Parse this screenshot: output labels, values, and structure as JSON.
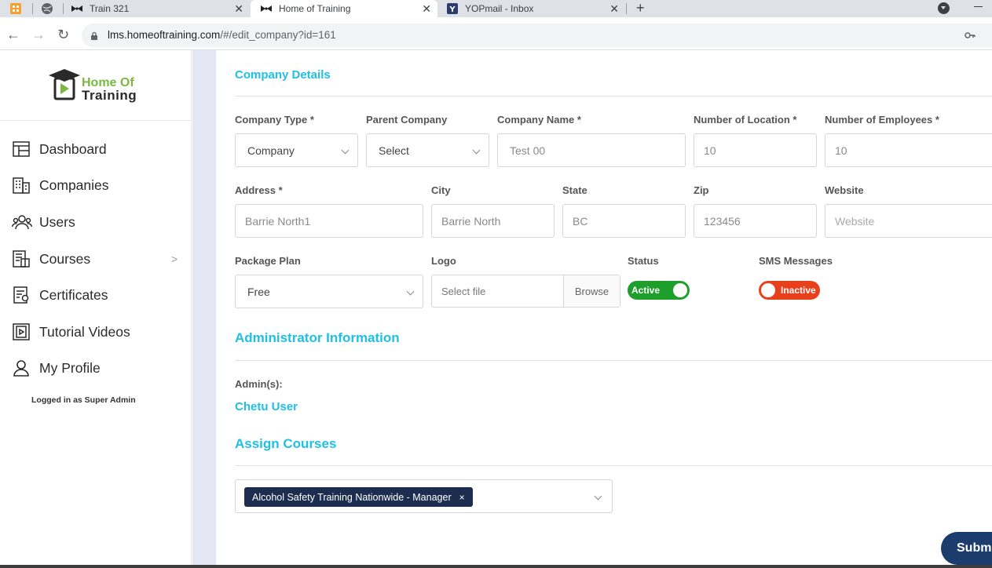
{
  "browser": {
    "tabs": [
      {
        "label": "",
        "icon": "app-icon"
      },
      {
        "label": "",
        "icon": "globe-icon"
      },
      {
        "label": "Train 321",
        "icon": "bowtie-icon"
      },
      {
        "label": "Home of Training",
        "icon": "bowtie-icon",
        "active": true
      },
      {
        "label": "YOPmail - Inbox",
        "icon": "yopmail-icon"
      }
    ],
    "url_domain": "lms.homeoftraining.com",
    "url_path": "/#/edit_company?id=161"
  },
  "sidebar": {
    "logo_line1": "Home Of",
    "logo_line2": "Training",
    "items": [
      {
        "label": "Dashboard",
        "icon": "dashboard-icon"
      },
      {
        "label": "Companies",
        "icon": "building-icon"
      },
      {
        "label": "Users",
        "icon": "users-icon"
      },
      {
        "label": "Courses",
        "icon": "courses-icon"
      },
      {
        "label": "Certificates",
        "icon": "certificate-icon"
      },
      {
        "label": "Tutorial Videos",
        "icon": "video-icon"
      },
      {
        "label": "My Profile",
        "icon": "profile-icon"
      }
    ],
    "logged_in": "Logged in as Super Admin"
  },
  "company": {
    "title": "Company Details",
    "fields": {
      "company_type": {
        "label": "Company Type *",
        "value": "Company"
      },
      "parent_company": {
        "label": "Parent Company",
        "value": "Select"
      },
      "company_name": {
        "label": "Company Name *",
        "value": "Test 00"
      },
      "num_locations": {
        "label": "Number of Location *",
        "value": "10"
      },
      "num_employees": {
        "label": "Number of Employees *",
        "value": "10"
      },
      "address": {
        "label": "Address *",
        "value": "Barrie North1"
      },
      "city": {
        "label": "City",
        "value": "Barrie North"
      },
      "state": {
        "label": "State",
        "value": "BC"
      },
      "zip": {
        "label": "Zip",
        "value": "123456"
      },
      "website": {
        "label": "Website",
        "placeholder": "Website"
      },
      "package_plan": {
        "label": "Package Plan",
        "value": "Free"
      },
      "logo": {
        "label": "Logo",
        "placeholder": "Select file",
        "browse": "Browse"
      },
      "status": {
        "label": "Status",
        "value": "Active",
        "color": "#1e9e2b"
      },
      "sms": {
        "label": "SMS Messages",
        "value": "Inactive",
        "color": "#e8401c"
      }
    }
  },
  "admin": {
    "title": "Administrator Information",
    "admins_label": "Admin(s):",
    "admin_name": "Chetu User"
  },
  "courses": {
    "title": "Assign Courses",
    "selected": [
      "Alcohol Safety Training Nationwide - Manager"
    ],
    "remove": "×"
  },
  "submit_label": "Submi",
  "colors": {
    "accent": "#1ec0e6",
    "navy": "#1d2d50",
    "active": "#1e9e2b",
    "inactive": "#e8401c"
  }
}
